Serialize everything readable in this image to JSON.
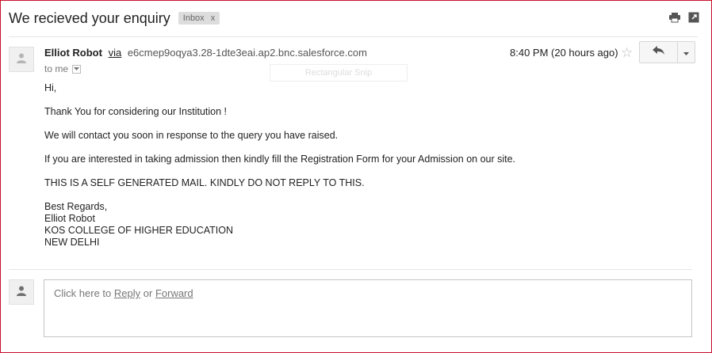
{
  "subject": "We recieved your enquiry",
  "label_chip": {
    "label": "Inbox",
    "remove": "x"
  },
  "icons": {
    "print": "print-icon",
    "new_window": "new-window-icon",
    "avatar": "person-icon",
    "reply": "reply-arrow-icon",
    "more": "chevron-down-icon",
    "star": "star-icon"
  },
  "sender": {
    "name": "Elliot Robot",
    "via": "via",
    "address": "e6cmep9oqya3.28-1dte3eai.ap2.bnc.salesforce.com",
    "to": "to me"
  },
  "overlay": {
    "snip_label": "Rectangular Snip"
  },
  "timestamp": "8:40 PM (20 hours ago)",
  "star_glyph": "☆",
  "body": {
    "greeting": "Hi,",
    "p1": "Thank You for considering our Institution !",
    "p2": "We will contact you soon in response to the query you have raised.",
    "p3": "If you are interested in taking admission then kindly fill the Registration Form for your Admission on our site.",
    "p4": "THIS IS A SELF GENERATED MAIL. KINDLY DO NOT REPLY TO THIS.",
    "signature": [
      "Best Regards,",
      "Elliot Robot",
      "KOS COLLEGE OF HIGHER EDUCATION",
      "NEW DELHI"
    ]
  },
  "reply_box": {
    "prefix": "Click here to",
    "reply": "Reply",
    "or": "or",
    "forward": "Forward"
  },
  "colors": {
    "frame_border": "#c8102e",
    "label_bg": "#dddddd",
    "text": "#222222",
    "muted": "#777777"
  }
}
